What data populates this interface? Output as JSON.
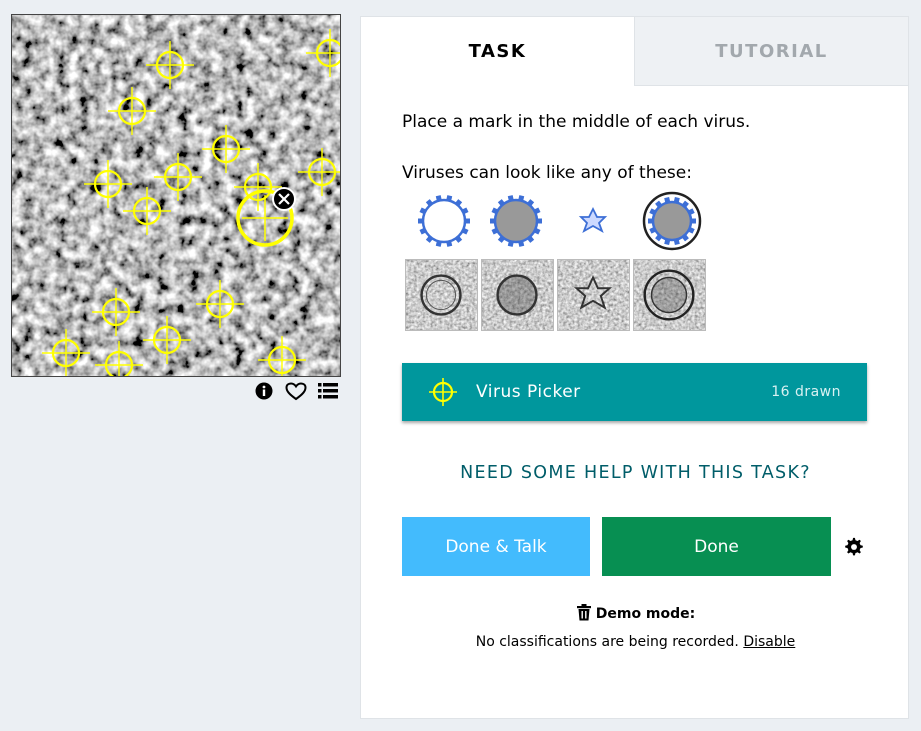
{
  "tabs": {
    "task": "TASK",
    "tutorial": "TUTORIAL"
  },
  "task": {
    "instruction": "Place a mark in the middle of each virus.",
    "examples_label": "Viruses can look like any of these:"
  },
  "tool": {
    "label": "Virus Picker",
    "count": "16 drawn",
    "color": "#00979d",
    "marker_color": "#ffff00"
  },
  "help_link": "NEED SOME HELP WITH THIS TASK?",
  "buttons": {
    "done_talk": "Done & Talk",
    "done": "Done"
  },
  "demo": {
    "title": "Demo mode:",
    "message": "No classifications are being recorded.",
    "disable": "Disable"
  },
  "subject_tools": [
    "info-icon",
    "heart-icon",
    "list-icon"
  ],
  "colors": {
    "background": "#ebeff3",
    "done_talk": "#43bbfd",
    "done": "#078f52",
    "help": "#005d69",
    "marker": "#ffff00"
  }
}
